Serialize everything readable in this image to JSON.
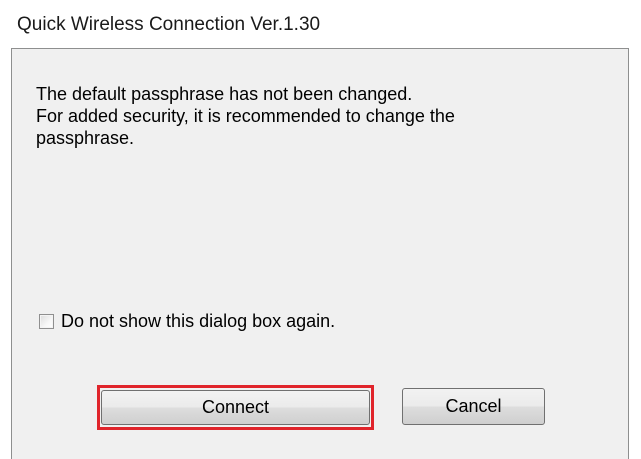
{
  "window": {
    "title": "Quick Wireless Connection Ver.1.30"
  },
  "message": {
    "line1": "The default passphrase has not been changed.",
    "line2": "For added security, it is recommended to change the",
    "line3": "passphrase."
  },
  "checkbox": {
    "label": "Do not show this dialog box again.",
    "checked": false
  },
  "buttons": {
    "connect_label": "Connect",
    "cancel_label": "Cancel"
  },
  "colors": {
    "highlight": "#e0242b"
  }
}
